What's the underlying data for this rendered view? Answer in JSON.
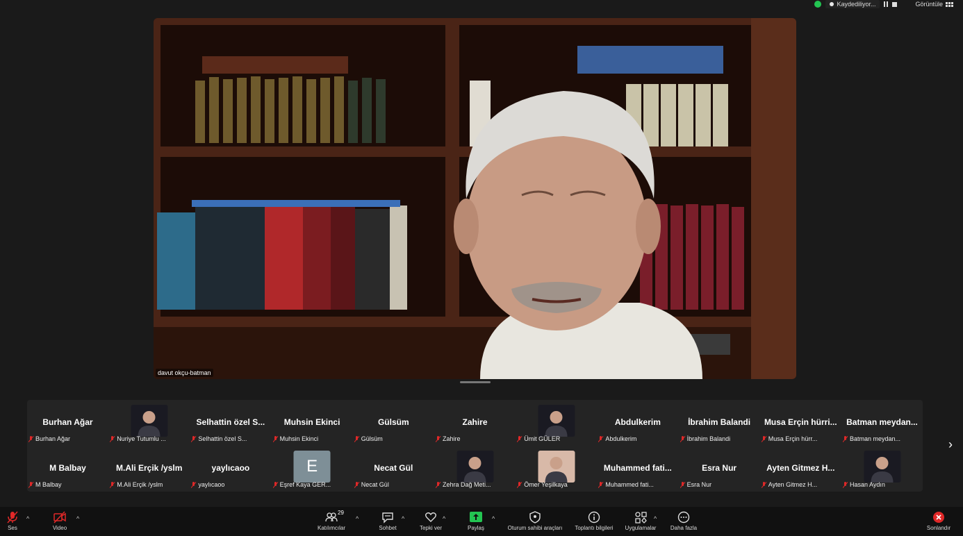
{
  "top_status": {
    "recording_label": "Kaydediliyor...",
    "view_label": "Görüntüle"
  },
  "speaker": {
    "name": "davut okçu-batman"
  },
  "gallery": {
    "tiles": [
      {
        "display": "Burhan Ağar",
        "label": "Burhan Ağar",
        "thumb": ""
      },
      {
        "display": "",
        "label": "Nuriye Tutumlu ...",
        "thumb": "photo"
      },
      {
        "display": "Selhattin özel S...",
        "label": "Selhattin özel S...",
        "thumb": ""
      },
      {
        "display": "Muhsin Ekinci",
        "label": "Muhsin Ekinci",
        "thumb": ""
      },
      {
        "display": "Gülsüm",
        "label": "Gülsüm",
        "thumb": ""
      },
      {
        "display": "Zahire",
        "label": "Zahire",
        "thumb": ""
      },
      {
        "display": "",
        "label": "Ümit GÜLER",
        "thumb": "photo"
      },
      {
        "display": "Abdulkerim",
        "label": "Abdulkerim",
        "thumb": ""
      },
      {
        "display": "İbrahim Balandi",
        "label": "İbrahim Balandi",
        "thumb": ""
      },
      {
        "display": "Musa Erçin hürri...",
        "label": "Musa Erçin hürr...",
        "thumb": ""
      },
      {
        "display": "Batman meydan...",
        "label": "Batman meydan...",
        "thumb": ""
      },
      {
        "display": "M Balbay",
        "label": "M Balbay",
        "thumb": ""
      },
      {
        "display": "M.Ali Erçik /yslm",
        "label": "M.Ali Erçik /yslm",
        "thumb": ""
      },
      {
        "display": "yaylıcaoo",
        "label": "yaylıcaoo",
        "thumb": ""
      },
      {
        "display": "",
        "label": "Eşref Kaya GER...",
        "thumb": "letter",
        "letter": "E"
      },
      {
        "display": "Necat Gül",
        "label": "Necat Gül",
        "thumb": ""
      },
      {
        "display": "",
        "label": "Zehra Dağ Meti...",
        "thumb": "photo"
      },
      {
        "display": "",
        "label": "Ömer Yeşilkaya",
        "thumb": "photo"
      },
      {
        "display": "Muhammed fati...",
        "label": "Muhammed fati...",
        "thumb": ""
      },
      {
        "display": "Esra Nur",
        "label": "Esra Nur",
        "thumb": ""
      },
      {
        "display": "Ayten Gitmez H...",
        "label": "Ayten Gitmez H...",
        "thumb": ""
      },
      {
        "display": "",
        "label": "Hasan Aydın",
        "thumb": "photo"
      }
    ]
  },
  "toolbar": {
    "audio": "Ses",
    "video": "Video",
    "participants": "Katılımcılar",
    "participants_count": "29",
    "chat": "Sohbet",
    "react": "Tepki ver",
    "share": "Paylaş",
    "host_tools": "Oturum sahibi araçları",
    "meeting_info": "Toplantı bilgileri",
    "apps": "Uygulamalar",
    "more": "Daha fazla",
    "end": "Sonlandır"
  },
  "colors": {
    "background": "#1a1a1a",
    "tile_bg": "#242424",
    "muted_red": "#e02828",
    "share_green": "#23c552",
    "end_red": "#e02828"
  }
}
